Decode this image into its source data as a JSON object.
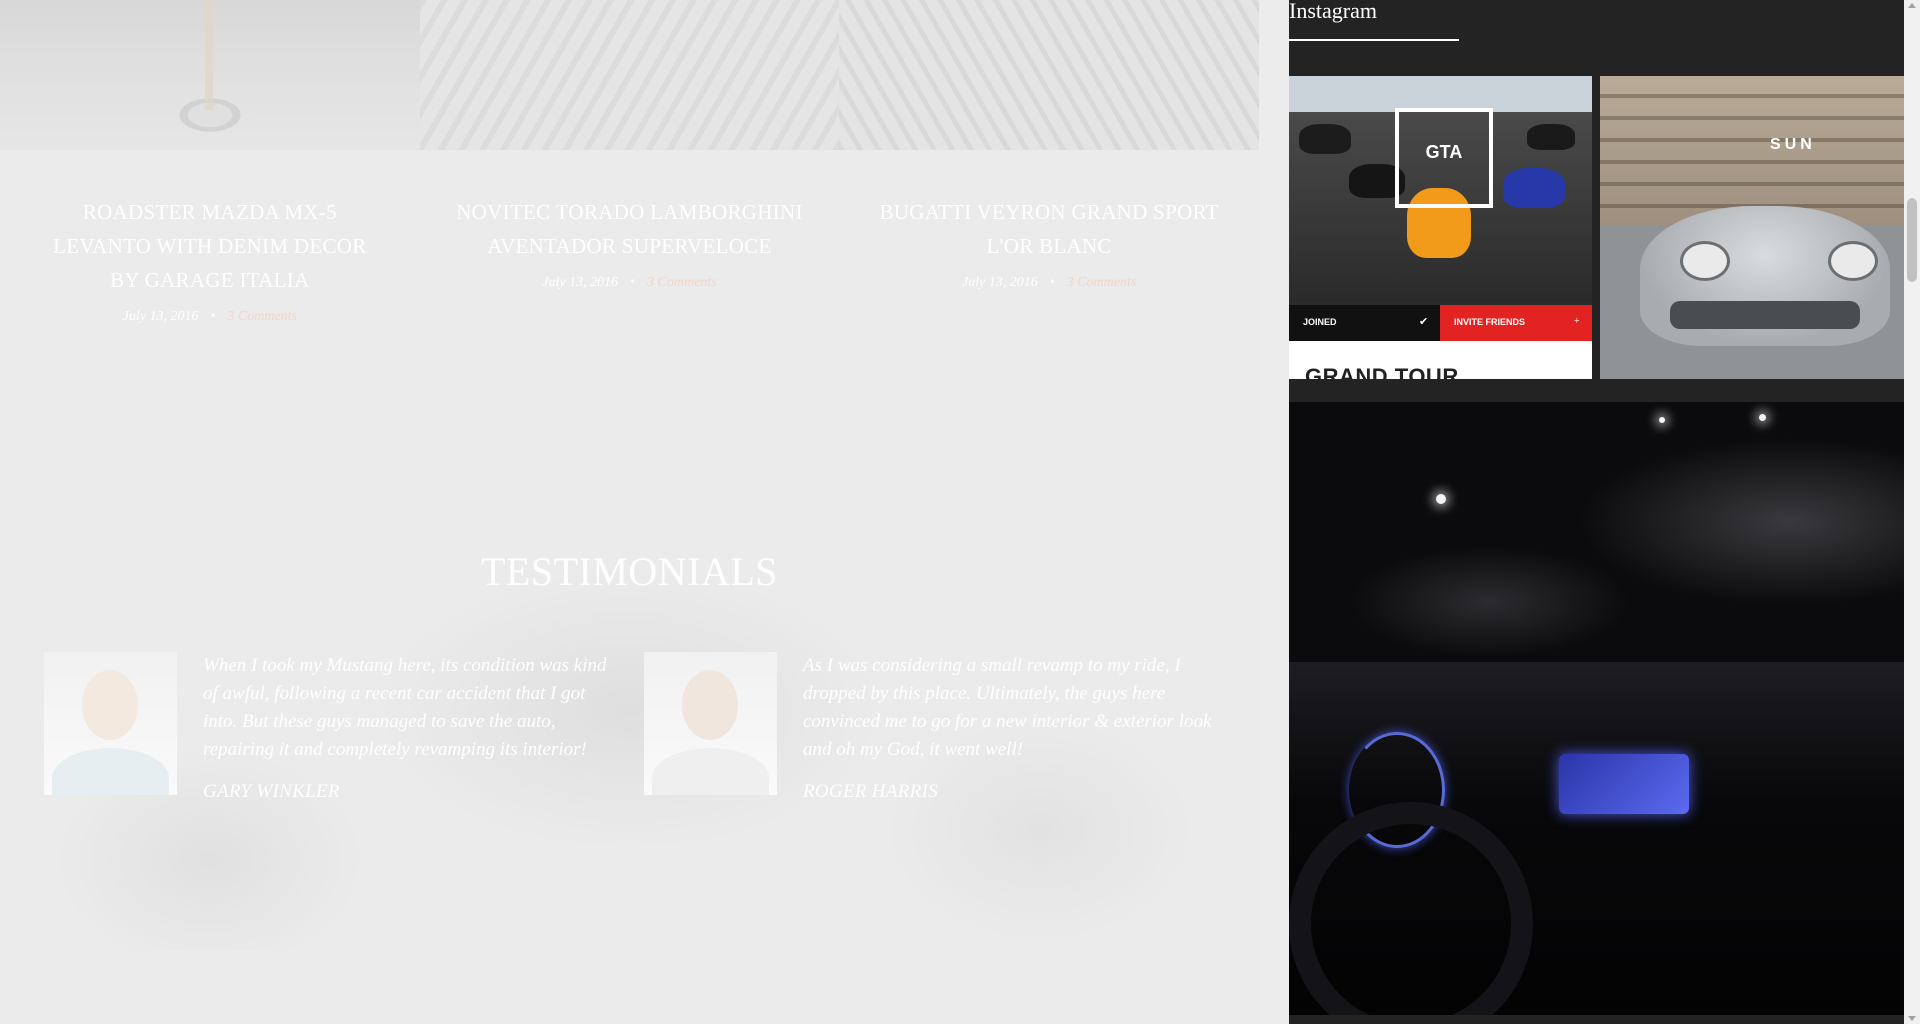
{
  "posts": [
    {
      "title": "ROADSTER MAZDA MX-5 LEVANTO WITH DENIM DECOR BY GARAGE ITALIA",
      "date": "July 13, 2016",
      "separator": "•",
      "comments": "3 Comments"
    },
    {
      "title": "NOVITEC TORADO LAMBORGHINI AVENTADOR SUPERVELOCE",
      "date": "July 13, 2016",
      "separator": "•",
      "comments": "3 Comments"
    },
    {
      "title": "BUGATTI VEYRON GRAND SPORT L'OR BLANC",
      "date": "July 13, 2016",
      "separator": "•",
      "comments": "3 Comments"
    }
  ],
  "testimonials": {
    "title": "TESTIMONIALS",
    "items": [
      {
        "quote": "When I took my Mustang here, its condition was kind of awful, following a recent car accident that I got into. But these guys managed to save the auto, repairing it and completely revamping its interior!",
        "author": "GARY WINKLER"
      },
      {
        "quote": "As I was considering a small revamp to my ride, I dropped by this place. Ultimately, the guys here convinced me to go for a new interior & exterior look and oh my God, it went well!",
        "author": "ROGER HARRIS"
      }
    ]
  },
  "instagram": {
    "title": "Instagram",
    "tile1": {
      "badge": "GTA",
      "joined": "JOINED",
      "check": "✔",
      "invite": "INVITE FRIENDS",
      "plus": "+",
      "headline": "GRAND TOUR"
    },
    "tile2": {
      "sign": "SUN"
    }
  },
  "colors": {
    "page_background": "#ebebeb",
    "sidebar_background": "#232323",
    "comment_link": "#f2d5c9",
    "accent_red": "#e32222"
  }
}
